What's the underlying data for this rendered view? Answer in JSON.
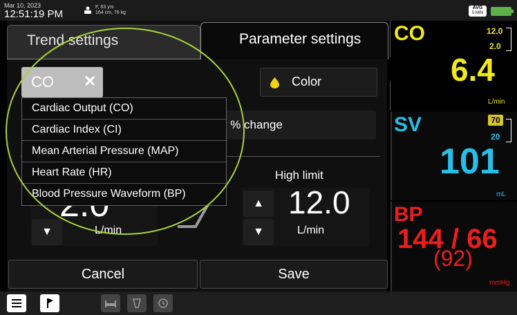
{
  "status": {
    "date": "Mar 10, 2023",
    "time": "12:51:19 PM",
    "patient_line1": "F, 63 yrs",
    "patient_line2": "164 cm, 76 kg",
    "avg_label": "AVG",
    "avg_interval": "5 MIN",
    "battery_color": "#5eb04a"
  },
  "tabs": {
    "trend": "Trend settings",
    "parameter": "Parameter settings"
  },
  "settings": {
    "selected_param": "CO",
    "remove_icon": "close-icon",
    "color_label": "Color",
    "color_value": "#f1d30f",
    "percent_change_label": "v % change",
    "high_limit_label": "High limit",
    "low_value": "2.0",
    "low_unit": "L/min",
    "high_value": "12.0",
    "high_unit": "L/min",
    "cancel_label": "Cancel",
    "save_label": "Save"
  },
  "dropdown": {
    "options": [
      "Cardiac Output (CO)",
      "Cardiac Index (CI)",
      "Mean Arterial Pressure (MAP)",
      "Heart Rate (HR)",
      "Blood Pressure Waveform (BP)"
    ]
  },
  "vitals": {
    "co": {
      "name": "CO",
      "value": "6.4",
      "unit": "L/min",
      "high": "12.0",
      "low": "2.0",
      "color": "#f1e81c"
    },
    "sv": {
      "name": "SV",
      "value": "101",
      "unit": "mL",
      "high": "70",
      "low": "20",
      "color": "#27bfe6"
    },
    "bp": {
      "name": "BP",
      "value": "144 / 66",
      "map": "(92)",
      "unit": "mmHg",
      "color": "#ee1c1c"
    }
  },
  "highlight_color": "#a8d53a"
}
